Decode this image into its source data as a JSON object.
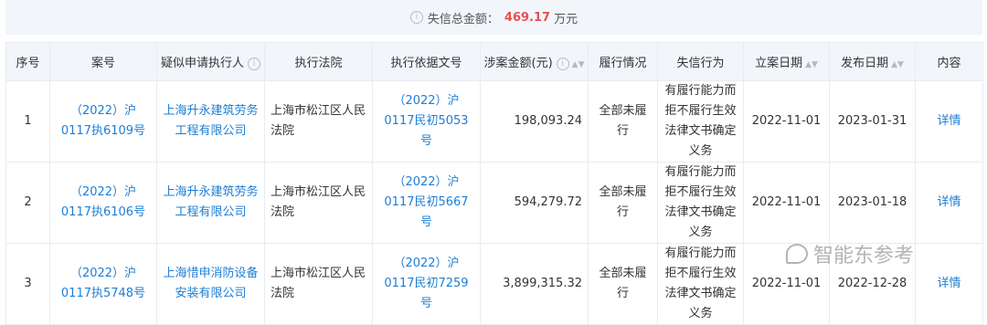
{
  "summary": {
    "label": "失信总金额：",
    "amount": "469.17",
    "unit": "万元"
  },
  "table": {
    "headers": {
      "index": "序号",
      "case_no": "案号",
      "applicant": "疑似申请执行人",
      "court": "执行法院",
      "basis_doc": "执行依据文号",
      "amount": "涉案金额(元)",
      "performance": "履行情况",
      "behavior": "失信行为",
      "filing_date": "立案日期",
      "publish_date": "发布日期",
      "content": "内容"
    },
    "rows": [
      {
        "index": "1",
        "case_no": "（2022）沪0117执6109号",
        "applicant": "上海升永建筑劳务工程有限公司",
        "court": "上海市松江区人民法院",
        "basis_doc": "（2022）沪0117民初5053号",
        "amount": "198,093.24",
        "performance": "全部未履行",
        "behavior": "有履行能力而拒不履行生效法律文书确定义务",
        "filing_date": "2022-11-01",
        "publish_date": "2023-01-31",
        "detail": "详情"
      },
      {
        "index": "2",
        "case_no": "（2022）沪0117执6106号",
        "applicant": "上海升永建筑劳务工程有限公司",
        "court": "上海市松江区人民法院",
        "basis_doc": "（2022）沪0117民初5667号",
        "amount": "594,279.72",
        "performance": "全部未履行",
        "behavior": "有履行能力而拒不履行生效法律文书确定义务",
        "filing_date": "2022-11-01",
        "publish_date": "2023-01-18",
        "detail": "详情"
      },
      {
        "index": "3",
        "case_no": "（2022）沪0117执5748号",
        "applicant": "上海惜申消防设备安装有限公司",
        "court": "上海市松江区人民法院",
        "basis_doc": "（2022）沪0117民初7259号",
        "amount": "3,899,315.32",
        "performance": "全部未履行",
        "behavior": "有履行能力而拒不履行生效法律文书确定义务",
        "filing_date": "2022-11-01",
        "publish_date": "2022-12-28",
        "detail": "详情"
      }
    ]
  },
  "watermark": "智能东参考",
  "colors": {
    "link": "#1c7ed6",
    "amount_red": "#e8504f",
    "header_bg": "#f2f6fb"
  }
}
